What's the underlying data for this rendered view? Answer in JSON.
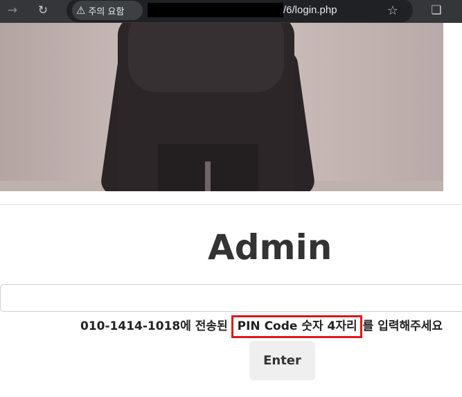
{
  "browser": {
    "security_warning": "주의 요함",
    "url_visible": "/6/login.php",
    "icons": {
      "back": "back-arrow-icon",
      "reload": "reload-icon",
      "warning": "warning-triangle-icon",
      "bookmark": "star-icon",
      "extensions": "puzzle-icon"
    }
  },
  "page": {
    "title": "Admin",
    "pin_input": {
      "value": "",
      "placeholder": ""
    },
    "hint": {
      "before": "010-1414-1018에 전송된",
      "highlight": "PIN Code 숫자 4자리",
      "after": "를 입력해주세요"
    },
    "submit_label": "Enter",
    "highlight_color": "#e5141b"
  }
}
